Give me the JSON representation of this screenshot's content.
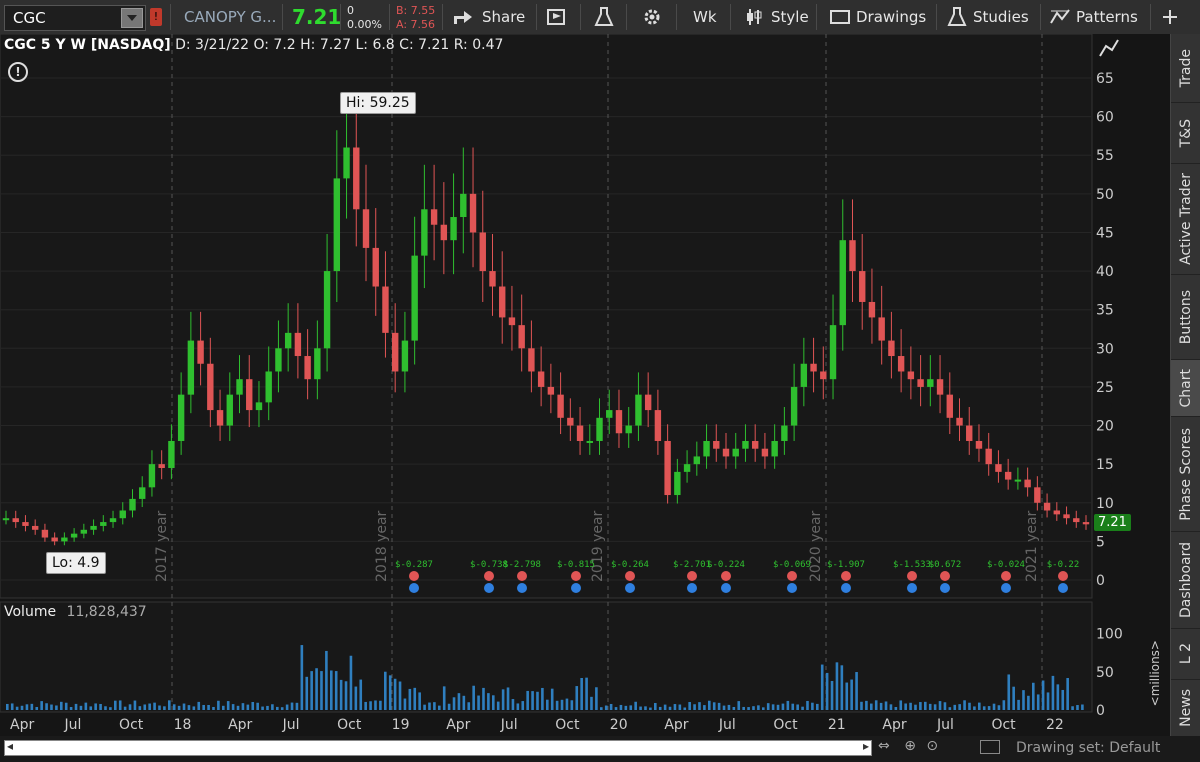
{
  "toolbar": {
    "symbol": "CGC",
    "company": "CANOPY G...",
    "last": "7.21",
    "change": "0",
    "change_pct": "0.00%",
    "bid": "B: 7.55",
    "ask": "A: 7.56",
    "share_label": "Share",
    "aggregation": "Wk",
    "style_label": "Style",
    "drawings_label": "Drawings",
    "studies_label": "Studies",
    "patterns_label": "Patterns"
  },
  "header": {
    "title": "CGC 5 Y W [NASDAQ]",
    "date": "D: 3/21/22",
    "open": "O: 7.2",
    "high": "H: 7.27",
    "low": "L: 6.8",
    "close": "C: 7.21",
    "range": "R: 0.47"
  },
  "callouts": {
    "hi": "Hi: 59.25",
    "lo": "Lo: 4.9"
  },
  "volume": {
    "label": "Volume",
    "value": "11,828,437",
    "units": "<millions>"
  },
  "price_tag": "7.21",
  "right_tabs": [
    "Trade",
    "T&S",
    "Active Trader",
    "Buttons",
    "Chart",
    "Phase Scores",
    "Dashboard",
    "L 2",
    "News"
  ],
  "bottom": {
    "drawing_set": "Drawing set: Default"
  },
  "colors": {
    "up": "#2fbf2f",
    "down": "#e05555",
    "volume": "#2f7fbf",
    "bg": "#151515"
  },
  "chart_data": {
    "type": "candlestick",
    "price_axis": [
      "65",
      "60",
      "55",
      "50",
      "45",
      "40",
      "35",
      "30",
      "25",
      "20",
      "15",
      "10",
      "5",
      "0"
    ],
    "ylim": [
      0,
      67
    ],
    "year_markers": [
      "2017 year",
      "2018 year",
      "2019 year",
      "2020 year",
      "2021 year"
    ],
    "x_ticks": [
      "Apr",
      "Jul",
      "Oct",
      "18",
      "Apr",
      "Jul",
      "Oct",
      "19",
      "Apr",
      "Jul",
      "Oct",
      "20",
      "Apr",
      "Jul",
      "Oct",
      "21",
      "Apr",
      "Jul",
      "Oct",
      "22"
    ],
    "dividend_labels": [
      "$-0.287",
      "$-0.738",
      "$-2.798",
      "$-0.815",
      "$-0.264",
      "$-2.701",
      "$-0.224",
      "$-0.069",
      "$-1.907",
      "$-1.533",
      "$0.672",
      "$-0.024",
      "$-0.22"
    ],
    "price_path": [
      8,
      7.5,
      7,
      6.5,
      5.5,
      5,
      5.5,
      6,
      6.5,
      7,
      7.5,
      8,
      9,
      10.5,
      12,
      15,
      14.5,
      18,
      24,
      31,
      28,
      22,
      20,
      24,
      26,
      22,
      23,
      27,
      30,
      32,
      29,
      26,
      30,
      40,
      52,
      56,
      48,
      43,
      38,
      32,
      27,
      31,
      42,
      48,
      46,
      44,
      47,
      50,
      45,
      40,
      38,
      34,
      33,
      30,
      27,
      25,
      24,
      21,
      20,
      18,
      18,
      21,
      22,
      19,
      20,
      24,
      22,
      18,
      11,
      14,
      15,
      16,
      18,
      17,
      16,
      17,
      18,
      17,
      16,
      18,
      20,
      25,
      28,
      27,
      26,
      33,
      44,
      40,
      36,
      34,
      31,
      29,
      27,
      26,
      25,
      26,
      24,
      21,
      20,
      18,
      17,
      15,
      14,
      13,
      13,
      12,
      10,
      9,
      8.5,
      8,
      7.5,
      7.21
    ],
    "volume_axis": [
      "100",
      "50",
      "0"
    ]
  }
}
